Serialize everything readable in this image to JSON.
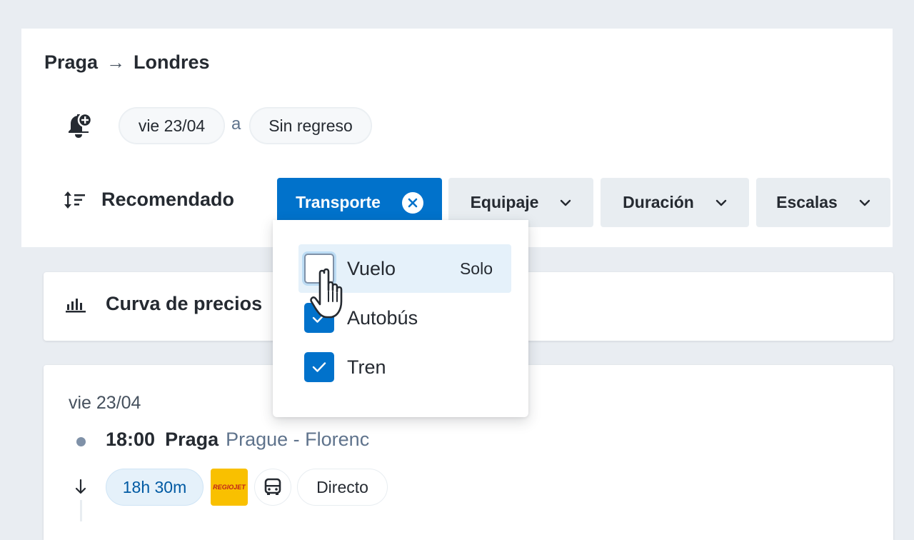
{
  "route": {
    "origin": "Praga",
    "arrow": "→",
    "destination": "Londres"
  },
  "dates": {
    "outbound": "vie 23/04",
    "separator": "a",
    "return": "Sin regreso"
  },
  "sort": {
    "label": "Recomendado"
  },
  "filters": [
    {
      "label": "Transporte",
      "active": true
    },
    {
      "label": "Equipaje"
    },
    {
      "label": "Duración"
    },
    {
      "label": "Escalas"
    }
  ],
  "transport_dropdown": {
    "options": [
      {
        "label": "Vuelo",
        "checked": false,
        "only_label": "Solo"
      },
      {
        "label": "Autobús",
        "checked": true
      },
      {
        "label": "Tren",
        "checked": true
      }
    ]
  },
  "price_curve": {
    "label": "Curva de precios"
  },
  "result": {
    "date": "vie 23/04",
    "departure_time": "18:00",
    "departure_city": "Praga",
    "departure_station": "Prague - Florenc",
    "duration": "18h 30m",
    "carrier_logo_text": "REGIOJET",
    "transfer": "Directo"
  },
  "colors": {
    "primary": "#0172cb",
    "background": "#e9edf2",
    "chip_bg": "#e8edf1",
    "text": "#252a31",
    "muted": "#5f738c",
    "carrier_yellow": "#f9c000"
  }
}
